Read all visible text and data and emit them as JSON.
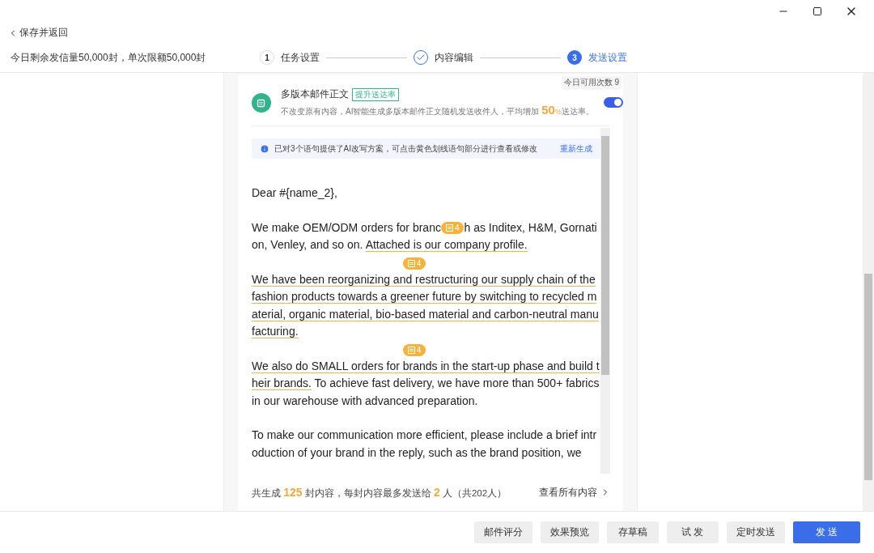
{
  "back_link": {
    "label": "保存并返回"
  },
  "quota": "今日剩余发信量50,000封，单次限额50,000封",
  "steps": [
    {
      "number": "1",
      "label": "任务设置",
      "completed": false,
      "selected": false
    },
    {
      "label": "内容编辑",
      "completed": true,
      "selected": false
    },
    {
      "number": "3",
      "label": "发送设置",
      "completed": false,
      "selected": true
    }
  ],
  "feature": {
    "usage": "今日可用次数 9",
    "title": "多版本邮件正文",
    "tag": "提升送达率",
    "on": true,
    "description": [
      {
        "kind": "plain",
        "text": "不改变原有内容，AI智能生成多版本邮件正文随机发送收件人，平均增加 "
      },
      {
        "kind": "big",
        "text": "50"
      },
      {
        "kind": "small",
        "text": "%"
      },
      {
        "kind": "plain",
        "text": "送达率。"
      }
    ]
  },
  "notice": {
    "text": "已对3个语句提供了AI改写方案，可点击黄色划线语句部分进行查看或修改",
    "action": "重新生成"
  },
  "email": [
    {
      "segments": [
        {
          "kind": "text",
          "text": "Dear #{name_2},"
        }
      ]
    },
    {
      "segments": [
        {
          "kind": "text",
          "text": "We make OEM/ODM orders for branc"
        },
        {
          "kind": "badge",
          "text": "4"
        },
        {
          "kind": "text",
          "text": "h as Inditex, H&M, Gornation, Venley, and so on. "
        },
        {
          "kind": "rewritten",
          "text": "Attached is our company profile."
        }
      ]
    },
    {
      "badge": "4",
      "segments": [
        {
          "kind": "rewritten",
          "text": "We have been reorganizing and restructuring our supply chain of the fashion products towards a greener future by switching to recycled material, organic material, bio-based material and carbon-neutral manufacturing."
        }
      ]
    },
    {
      "badge": "4",
      "segments": [
        {
          "kind": "rewritten",
          "text": "We also do SMALL orders for brands in the start-up phase and build their brands."
        },
        {
          "kind": "text",
          "text": " To achieve fast delivery, we have more than 500+ fabrics in our warehouse with advanced preparation."
        }
      ]
    },
    {
      "segments": [
        {
          "kind": "text",
          "text": "To make our communication more efficient, please include a brief introduction of your brand in the reply, such as the brand position, we"
        }
      ]
    }
  ],
  "summary": [
    {
      "kind": "plain",
      "text": "共生成 "
    },
    {
      "kind": "num",
      "text": "125"
    },
    {
      "kind": "plain",
      "text": " 封内容，每封内容最多发送给 "
    },
    {
      "kind": "num",
      "text": "2"
    },
    {
      "kind": "plain",
      "text": " 人（共202人）"
    }
  ],
  "view_all": "查看所有内容",
  "buttons": [
    {
      "label": "邮件评分",
      "primary": false
    },
    {
      "label": "效果预览",
      "primary": false
    },
    {
      "label": "存草稿",
      "primary": false
    },
    {
      "label": "试 发",
      "primary": false
    },
    {
      "label": "定时发送",
      "primary": false
    },
    {
      "label": "发 送",
      "primary": true
    }
  ]
}
